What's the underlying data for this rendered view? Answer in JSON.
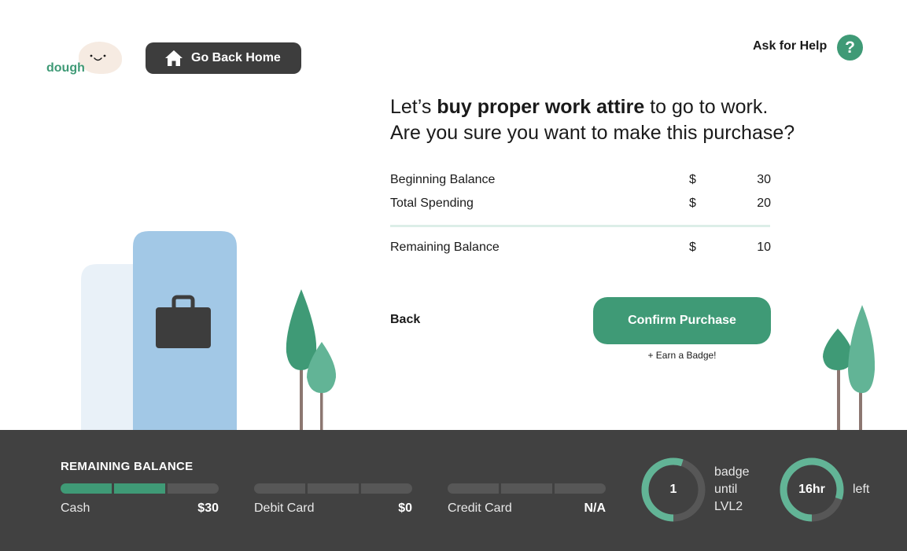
{
  "app": {
    "logo_text": "dough"
  },
  "header": {
    "home_label": "Go Back Home",
    "help_label": "Ask for Help",
    "help_icon_glyph": "?"
  },
  "prompt": {
    "line1_pre": "Let’s ",
    "line1_bold": "buy proper work attire",
    "line1_post": " to go to work.",
    "line2": "Are you sure you want to make this purchase?"
  },
  "summary": {
    "rows": [
      {
        "label": "Beginning Balance",
        "currency": "$",
        "amount": "30"
      },
      {
        "label": "Total Spending",
        "currency": "$",
        "amount": "20"
      },
      {
        "label": "Remaining Balance",
        "currency": "$",
        "amount": "10"
      }
    ]
  },
  "actions": {
    "back_label": "Back",
    "confirm_label": "Confirm Purchase",
    "badge_note": "+ Earn a Badge!"
  },
  "footer": {
    "title": "REMAINING BALANCE",
    "accounts": [
      {
        "name": "Cash",
        "value": "$30",
        "filled_segments": 2,
        "total_segments": 3
      },
      {
        "name": "Debit Card",
        "value": "$0",
        "filled_segments": 0,
        "total_segments": 3
      },
      {
        "name": "Credit Card",
        "value": "N/A",
        "filled_segments": 0,
        "total_segments": 3
      }
    ],
    "badge_ring": {
      "value": "1",
      "caption_1": "badge",
      "caption_2": "until",
      "caption_3": "LVL2",
      "progress": 0.55
    },
    "time_ring": {
      "value": "16hr",
      "caption": "left",
      "progress": 0.8
    }
  },
  "colors": {
    "accent": "#3f9a76",
    "dark": "#414141",
    "card_blue": "#a2c8e6",
    "card_light": "#e9f1f8"
  },
  "icons": [
    "home-icon",
    "help-icon",
    "briefcase-icon",
    "tree-icon"
  ]
}
